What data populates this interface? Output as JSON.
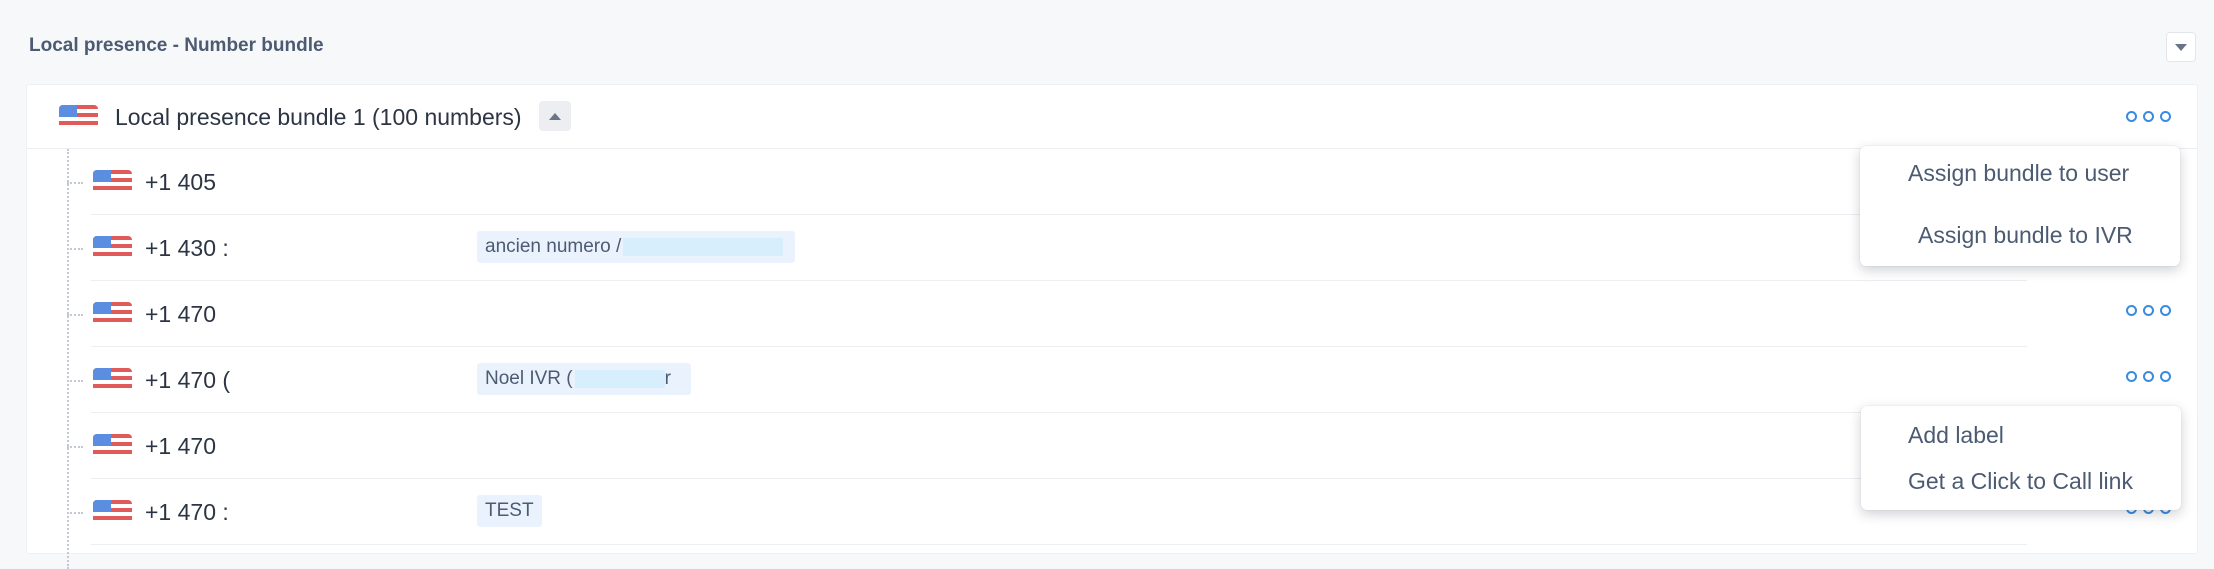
{
  "section": {
    "title": "Local presence - Number bundle"
  },
  "bundle": {
    "title": "Local presence bundle 1 (100 numbers)"
  },
  "numbers": [
    {
      "number": "+1 405",
      "label": ""
    },
    {
      "number": "+1 430 :",
      "label": "ancien numero /"
    },
    {
      "number": "+1 470",
      "label": ""
    },
    {
      "number": "+1 470 (",
      "label": "Noel IVR (",
      "label_tail": "r"
    },
    {
      "number": "+1 470",
      "label": ""
    },
    {
      "number": "+1 470 :",
      "label": "TEST"
    }
  ],
  "bundle_menu": {
    "items": [
      "Assign bundle to user",
      "Assign bundle to IVR"
    ]
  },
  "number_menu": {
    "items": [
      "Add label",
      "Get a Click to Call link"
    ]
  },
  "colors": {
    "accent": "#3a8be0",
    "label_chip": "#eaf3fd",
    "flag_red": "#e05a5a",
    "flag_blue": "#5b8ee0"
  },
  "icons": {
    "collapse": "chevron-down-icon",
    "expand": "chevron-up-icon",
    "more": "more-options-icon",
    "flag": "us-flag-icon"
  }
}
